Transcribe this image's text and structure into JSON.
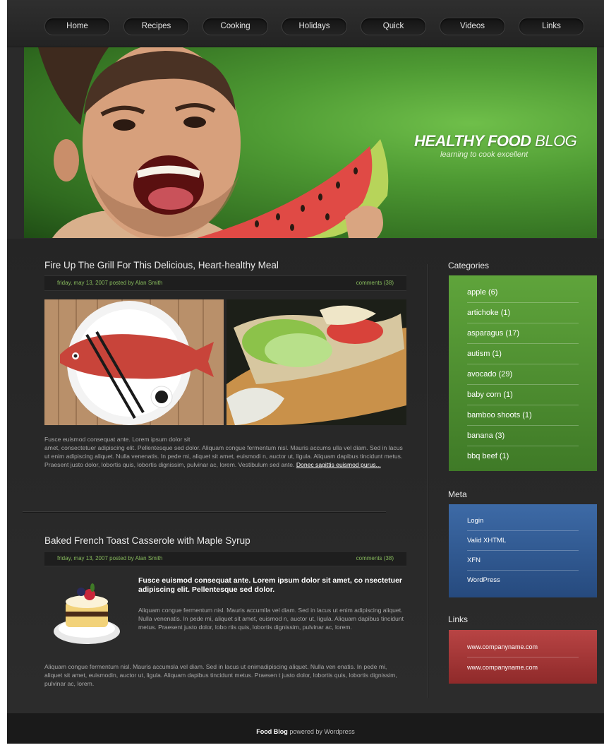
{
  "nav": [
    "Home",
    "Recipes",
    "Cooking",
    "Holidays",
    "Quick",
    "Videos",
    "Links"
  ],
  "hero": {
    "title_bold": "HEALTHY FOOD",
    "title_light": "BLOG",
    "subtitle": "learning to cook excellent"
  },
  "posts": [
    {
      "title": "Fire Up The Grill For This Delicious, Heart-healthy Meal",
      "meta": "friday, may 13, 2007  posted by Alan Smith",
      "comments": "comments (38)",
      "body_line1": "Fusce euismod consequat ante. Lorem ipsum dolor sit",
      "body": "amet, consectetuer adipiscing elit. Pellentesque sed dolor. Aliquam congue fermentum nisl. Mauris accums ulla vel diam. Sed in lacus ut enim adipiscing aliquet. Nulla venenatis. In pede mi, aliquet sit amet, euismodi n, auctor ut, ligula. Aliquam dapibus tincidunt metus. Praesent justo dolor, lobortis quis, lobortis dignissim, pulvinar ac, lorem. Vestibulum sed ante.",
      "more_link": "Donec sagittis euismod purus..."
    },
    {
      "title": "Baked French Toast Casserole with Maple Syrup",
      "meta": "friday, may 13, 2007  posted by Alan Smith",
      "comments": "comments (38)",
      "lead": "Fusce euismod consequat ante. Lorem ipsum dolor sit amet, co nsectetuer adipiscing elit. Pellentesque sed dolor.",
      "side_text": "Aliquam congue fermentum nisl. Mauris accumlla vel diam. Sed in lacus ut enim adipiscing aliquet. Nulla venenatis. In pede mi, aliquet sit amet, euismod n, auctor ut, ligula. Aliquam dapibus tincidunt metus. Praesent justo dolor, lobo rtis quis, lobortis dignissim, pulvinar ac, lorem.",
      "body": "Aliquam congue fermentum nisl. Mauris accumsla vel diam. Sed in lacus ut enimadipiscing aliquet. Nulla ven enatis. In pede mi, aliquet sit amet, euismodin, auctor ut, ligula. Aliquam dapibus tincidunt metus. Praesen t justo dolor, lobortis quis, lobortis dignissim, pulvinar ac, lorem."
    }
  ],
  "sidebar": {
    "categories_title": "Categories",
    "categories": [
      "apple (6)",
      "artichoke (1)",
      "asparagus (17)",
      "autism (1)",
      "avocado (29)",
      "baby corn (1)",
      "bamboo shoots (1)",
      "banana (3)",
      "bbq beef (1)"
    ],
    "meta_title": "Meta",
    "meta": [
      "Login",
      "Valid XHTML",
      "XFN",
      "WordPress"
    ],
    "links_title": "Links",
    "links": [
      "www.companyname.com",
      "www.companyname.com"
    ]
  },
  "footer": {
    "brand": "Food Blog",
    "rest": "powered by Wordpress"
  },
  "colors": {
    "accent_green": "#5fa43b",
    "meta_blue": "#3d6aa6",
    "links_red": "#b84444",
    "meta_text": "#86b95c"
  }
}
